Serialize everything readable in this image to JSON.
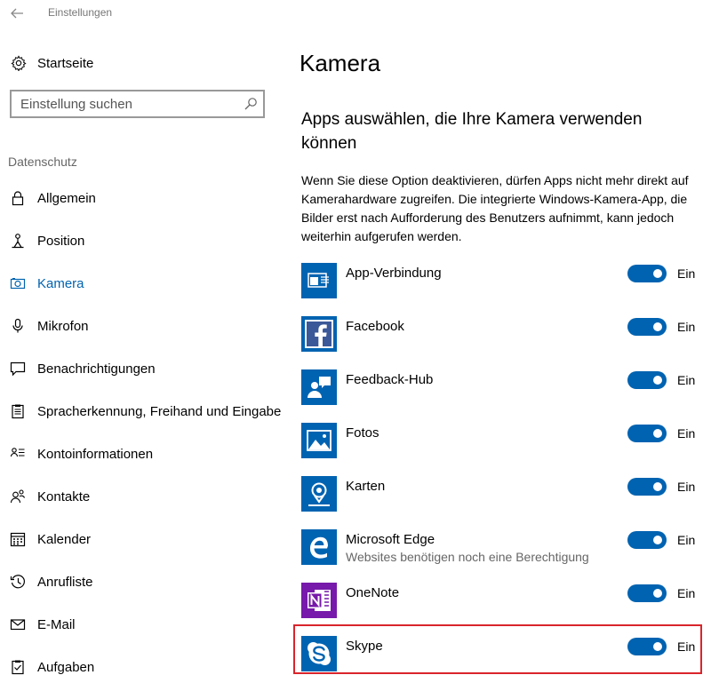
{
  "window": {
    "title": "Einstellungen"
  },
  "sidebar": {
    "home_label": "Startseite",
    "search_placeholder": "Einstellung suchen",
    "section_label": "Datenschutz",
    "items": [
      {
        "label": "Allgemein",
        "icon": "lock-icon"
      },
      {
        "label": "Position",
        "icon": "person-pin-icon"
      },
      {
        "label": "Kamera",
        "icon": "camera-icon",
        "active": true
      },
      {
        "label": "Mikrofon",
        "icon": "microphone-icon"
      },
      {
        "label": "Benachrichtigungen",
        "icon": "notification-icon"
      },
      {
        "label": "Spracherkennung, Freihand und Eingabe",
        "icon": "clipboard-icon"
      },
      {
        "label": "Kontoinformationen",
        "icon": "account-info-icon"
      },
      {
        "label": "Kontakte",
        "icon": "contacts-icon"
      },
      {
        "label": "Kalender",
        "icon": "calendar-icon"
      },
      {
        "label": "Anrufliste",
        "icon": "history-icon"
      },
      {
        "label": "E-Mail",
        "icon": "mail-icon"
      },
      {
        "label": "Aufgaben",
        "icon": "tasks-icon"
      }
    ]
  },
  "main": {
    "title": "Kamera",
    "subtitle": "Apps auswählen, die Ihre Kamera verwenden können",
    "description": "Wenn Sie diese Option deaktivieren, dürfen Apps nicht mehr direkt auf Kamerahardware zugreifen. Die integrierte Windows-Kamera-App, die Bilder erst nach Aufforderung des Benutzers aufnimmt, kann jedoch weiterhin aufgerufen werden.",
    "apps": [
      {
        "name": "App-Verbindung",
        "sub": "",
        "toggle": "Ein",
        "icon": "app-connector-icon",
        "color": "#0063b1"
      },
      {
        "name": "Facebook",
        "sub": "",
        "toggle": "Ein",
        "icon": "facebook-icon",
        "color": "#0063b1"
      },
      {
        "name": "Feedback-Hub",
        "sub": "",
        "toggle": "Ein",
        "icon": "feedback-hub-icon",
        "color": "#0063b1"
      },
      {
        "name": "Fotos",
        "sub": "",
        "toggle": "Ein",
        "icon": "photos-icon",
        "color": "#0063b1"
      },
      {
        "name": "Karten",
        "sub": "",
        "toggle": "Ein",
        "icon": "maps-icon",
        "color": "#0063b1"
      },
      {
        "name": "Microsoft Edge",
        "sub": "Websites benötigen noch eine Berechtigung",
        "toggle": "Ein",
        "icon": "edge-icon",
        "color": "#0063b1"
      },
      {
        "name": "OneNote",
        "sub": "",
        "toggle": "Ein",
        "icon": "onenote-icon",
        "color": "#7719aa"
      },
      {
        "name": "Skype",
        "sub": "",
        "toggle": "Ein",
        "icon": "skype-icon",
        "color": "#0063b1"
      }
    ]
  },
  "colors": {
    "accent": "#0063b1",
    "highlight": "#d9242b"
  }
}
